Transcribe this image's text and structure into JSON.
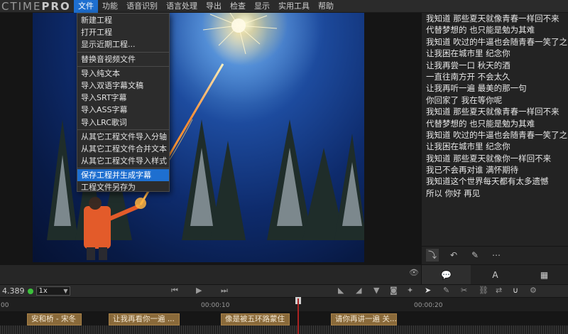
{
  "app": {
    "logo_main": "CTIME",
    "logo_pro": "PRO"
  },
  "menubar": {
    "items": [
      "文件",
      "功能",
      "语音识别",
      "语言处理",
      "导出",
      "检查",
      "显示",
      "实用工具",
      "帮助"
    ],
    "active_index": 0
  },
  "file_menu": {
    "items": [
      "新建工程",
      "打开工程",
      "显示近期工程...",
      "替换音视频文件",
      "导入纯文本",
      "导入双语字幕文稿",
      "导入SRT字幕",
      "导入ASS字幕",
      "导入LRC歌词",
      "从其它工程文件导入分轴",
      "从其它工程文件合并文本",
      "从其它工程文件导入样式",
      "保存工程并生成字幕",
      "工程文件另存为"
    ],
    "highlighted_index": 12
  },
  "lyrics": [
    "我知道 那些夏天就像青春一样回不来",
    "代替梦想的 也只能是勉为其难",
    "我知道 吹过的牛逼也会随青春一笑了之",
    "让我困在城市里 纪念你",
    "让我再尝一口 秋天的酒",
    "一直往南方开 不会太久",
    "让我再听一遍 最美的那一句",
    "你回家了 我在等你呢",
    "我知道 那些夏天就像青春一样回不来",
    "代替梦想的 也只能是勉为其难",
    "我知道 吹过的牛逼也会随青春一笑了之",
    "让我困在城市里 纪念你",
    "我知道 那些夏天就像你一样回不来",
    "我已不会再对谁 满怀期待",
    "我知道这个世界每天都有太多遗憾",
    "所以 你好 再见"
  ],
  "right_panel": {
    "tools": [
      "enter-icon",
      "undo-icon",
      "pen-icon",
      "more-icon"
    ],
    "tab_a_label": "A"
  },
  "transport": {
    "time": "4.389",
    "status_color": "#3cc13c",
    "speed": "1x"
  },
  "ruler": {
    "ticks": [
      "00",
      "00:00:10",
      "00:00:20"
    ]
  },
  "track": {
    "segments": [
      "安和桥 - 宋冬",
      "让我再看你一遍 ...",
      "像是被五环路蒙住",
      "请你再讲一遍 关..."
    ]
  },
  "colors": {
    "accent": "#1e6fd0",
    "segment": "#8a6a3a",
    "playhead": "#aa2222"
  }
}
